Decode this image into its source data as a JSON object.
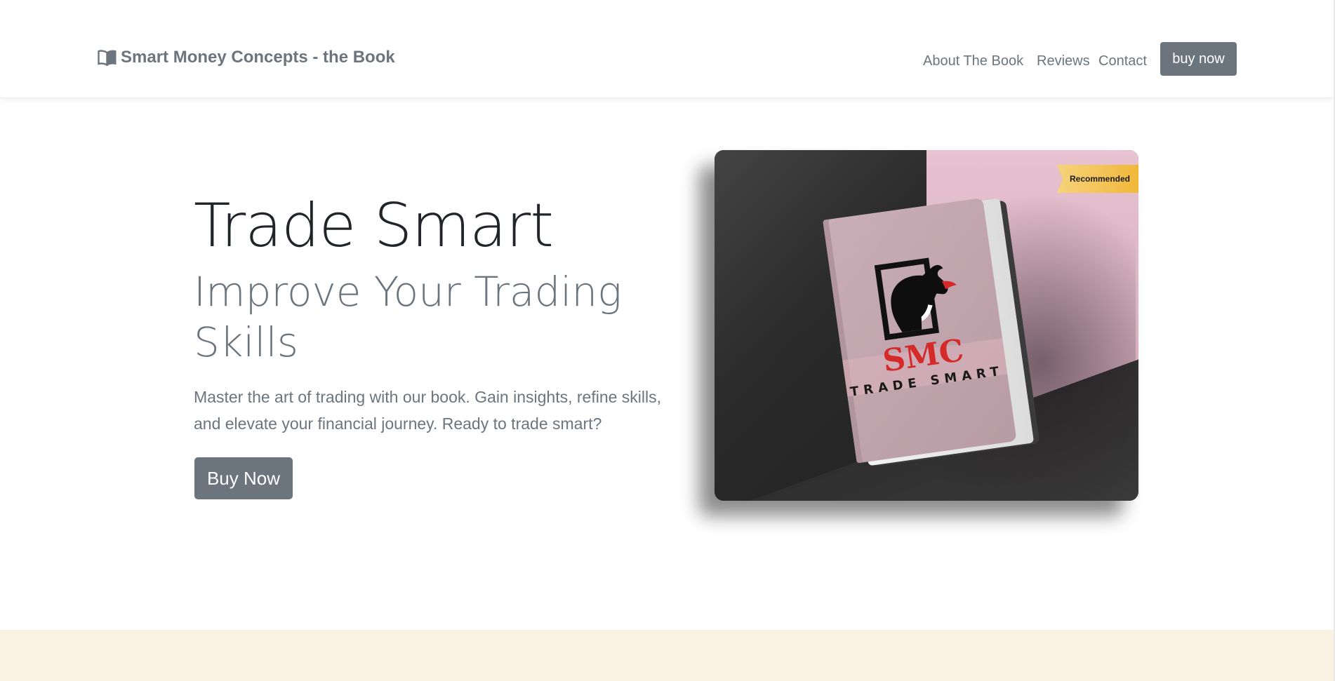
{
  "navbar": {
    "brand_label": "Smart Money Concepts - the Book",
    "brand_icon": "book-open-icon",
    "links": [
      {
        "label": "About The Book"
      },
      {
        "label": "Reviews"
      },
      {
        "label": "Contact"
      }
    ],
    "buy_label": "buy now"
  },
  "hero": {
    "title": "Trade Smart",
    "subtitle": "Improve Your Trading Skills",
    "text": "Master the art of trading with our book. Gain insights, refine skills, and elevate your financial journey. Ready to trade smart?",
    "buy_label": "Buy Now"
  },
  "card": {
    "ribbon_label": "Recommended",
    "book_title": "SMC",
    "book_subtitle": "TRADE SMART"
  },
  "colors": {
    "secondary": "#6c757d",
    "accent_red": "#d42a2a",
    "ribbon": "#f1b83a",
    "bottom_bg": "#faf3e4"
  }
}
